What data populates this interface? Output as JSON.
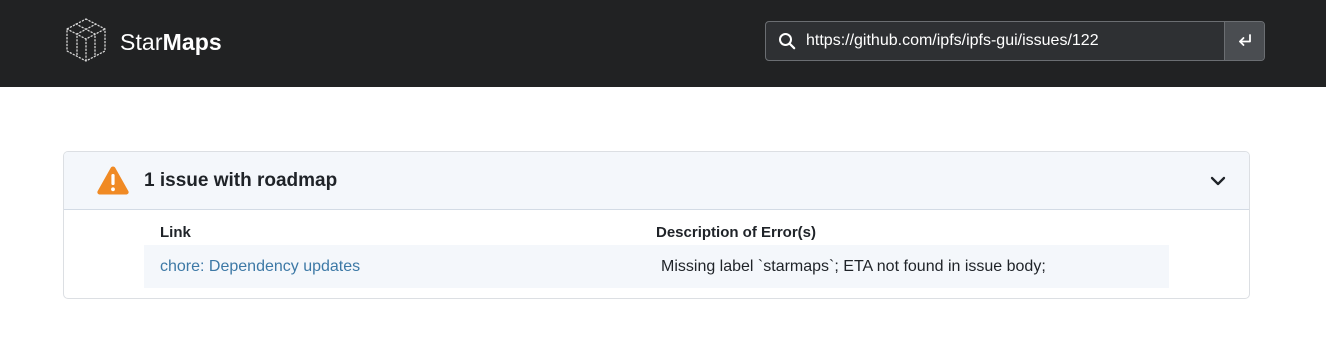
{
  "header": {
    "brand_light": "Star",
    "brand_bold": "Maps",
    "logo_icon": "cube-logo-icon",
    "search": {
      "icon": "search-icon",
      "value": "https://github.com/ipfs/ipfs-gui/issues/122",
      "submit_icon": "enter-return-icon"
    },
    "background_color": "#212223"
  },
  "issues_panel": {
    "warning_icon": "warning-triangle-icon",
    "warning_color": "#f08a24",
    "title": "1 issue with roadmap",
    "toggle_icon": "chevron-down-icon",
    "columns": [
      "Link",
      "Description of Error(s)"
    ],
    "rows": [
      {
        "link_text": "chore: Dependency updates",
        "description": "Missing label `starmaps`; ETA not found in issue body;"
      }
    ],
    "link_color": "#3d79a6"
  }
}
